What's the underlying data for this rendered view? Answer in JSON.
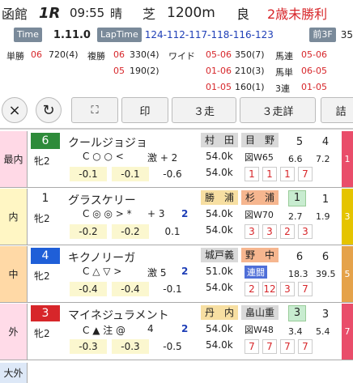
{
  "header": {
    "venue": "函館",
    "race_no": "1R",
    "time": "09:55",
    "weather": "晴",
    "surface": "芝",
    "distance": "1200m",
    "condition": "良",
    "class": "2歳未勝利"
  },
  "time_row": {
    "time_tag": "Time",
    "time_value": "1.11.0",
    "lap_tag": "LapTime",
    "lap_value": "124-112-117-118-116-123",
    "f3_tag": "前3F",
    "f3_value": "35"
  },
  "payouts": {
    "tan_label": "単勝",
    "tan_combo": "06",
    "tan_value": "720(4)",
    "fuku_label": "複勝",
    "fuku_rows": [
      {
        "combo": "06",
        "value": "330(4)"
      },
      {
        "combo": "05",
        "value": "190(2)"
      }
    ],
    "wide_label": "ワイド",
    "wide_rows": [
      {
        "combo": "05-06",
        "value": "350(7)"
      },
      {
        "combo": "01-06",
        "value": "210(3)"
      },
      {
        "combo": "01-05",
        "value": "160(1)"
      }
    ],
    "umaren_label": "馬連",
    "umaren_combo": "05-06",
    "umaren_value": "",
    "umatan_label": "馬単",
    "umatan_combo": "06-05",
    "umatan_value": "",
    "sanren_label": "3連",
    "sanren_combo": "01-05",
    "sanren_value": ""
  },
  "toolbar": {
    "close_icon": "×",
    "refresh_icon": "↻",
    "expand_icon": "⛶",
    "mark_label": "印",
    "three_label": "３走",
    "three_detail_label": "３走詳",
    "detail_label": "詰"
  },
  "rows": [
    {
      "position": "最内",
      "pos_color": "#ffd9e6",
      "num": "6",
      "num_bg": "#2e8b3a",
      "num_fg": "#ffffff",
      "sex_age": "牝2",
      "name": "クールジョジョ",
      "sym": "C ○ ○ <",
      "gk": "激 + 2",
      "dd": "",
      "rates": [
        "-0.1",
        "-0.1",
        "-0.6"
      ],
      "jockey": "村　田",
      "trainer": "目　野",
      "weight": "54.0k",
      "weight2": "54.0k",
      "detail": "図W65",
      "pop": "5",
      "odds": "4",
      "stat1": "6.6",
      "stat2": "7.2",
      "hist": [
        "1",
        "1",
        "1",
        "7"
      ],
      "order": "1",
      "order_bg": "#e94d6a",
      "trainer_style": "plain",
      "jockey_style": "plain",
      "pop_style": "plain"
    },
    {
      "position": "内",
      "pos_color": "#fff6c4",
      "num": "1",
      "num_bg": "#ffffff",
      "num_fg": "#222222",
      "sex_age": "牝2",
      "name": "グラスケリー",
      "sym": "C ◎ ◎ > *",
      "gk": "+ 3",
      "dd": "2",
      "rates": [
        "-0.2",
        "-0.2",
        "0.1"
      ],
      "jockey": "勝　浦",
      "trainer": "杉　浦",
      "weight": "54.0k",
      "weight2": "54.0k",
      "detail": "図W70",
      "pop": "1",
      "odds": "1",
      "stat1": "2.7",
      "stat2": "1.9",
      "hist": [
        "3",
        "3",
        "2",
        "3"
      ],
      "order": "3",
      "order_bg": "#e5c400",
      "trainer_style": "orange",
      "jockey_style": "gold",
      "pop_style": "boxed"
    },
    {
      "position": "中",
      "pos_color": "#ffd9a6",
      "num": "4",
      "num_bg": "#1f5fd8",
      "num_fg": "#ffffff",
      "sex_age": "牝2",
      "name": "キクノリーガ",
      "sym": "C △ ▽ >",
      "gk": "激 5",
      "dd": "2",
      "rates": [
        "-0.4",
        "-0.4",
        "-0.1"
      ],
      "jockey": "城戸義",
      "trainer": "野　中",
      "weight": "51.0k",
      "weight2": "54.0k",
      "detail": "連闘",
      "pop": "6",
      "odds": "6",
      "stat1": "18.3",
      "stat2": "39.5",
      "hist": [
        "2",
        "12",
        "3",
        "7"
      ],
      "order": "5",
      "order_bg": "#e5a24a",
      "trainer_style": "orange",
      "jockey_style": "plain",
      "pop_style": "plain"
    },
    {
      "position": "外",
      "pos_color": "#ffdbe8",
      "num": "3",
      "num_bg": "#d7262a",
      "num_fg": "#ffffff",
      "sex_age": "牝2",
      "name": "マイネジュラメント",
      "sym": "C ▲ 注 @",
      "gk": "4",
      "dd": "2",
      "rates": [
        "-0.3",
        "-0.3",
        "-0.5"
      ],
      "jockey": "丹　内",
      "trainer": "畠山重",
      "weight": "54.0k",
      "weight2": "54.0k",
      "detail": "図W48",
      "pop": "3",
      "odds": "3",
      "stat1": "3.4",
      "stat2": "5.4",
      "hist": [
        "7",
        "7",
        "7",
        "7"
      ],
      "order": "7",
      "order_bg": "#e94d6a",
      "trainer_style": "plain",
      "jockey_style": "gold",
      "pop_style": "boxed"
    }
  ],
  "footer_position": "大外"
}
